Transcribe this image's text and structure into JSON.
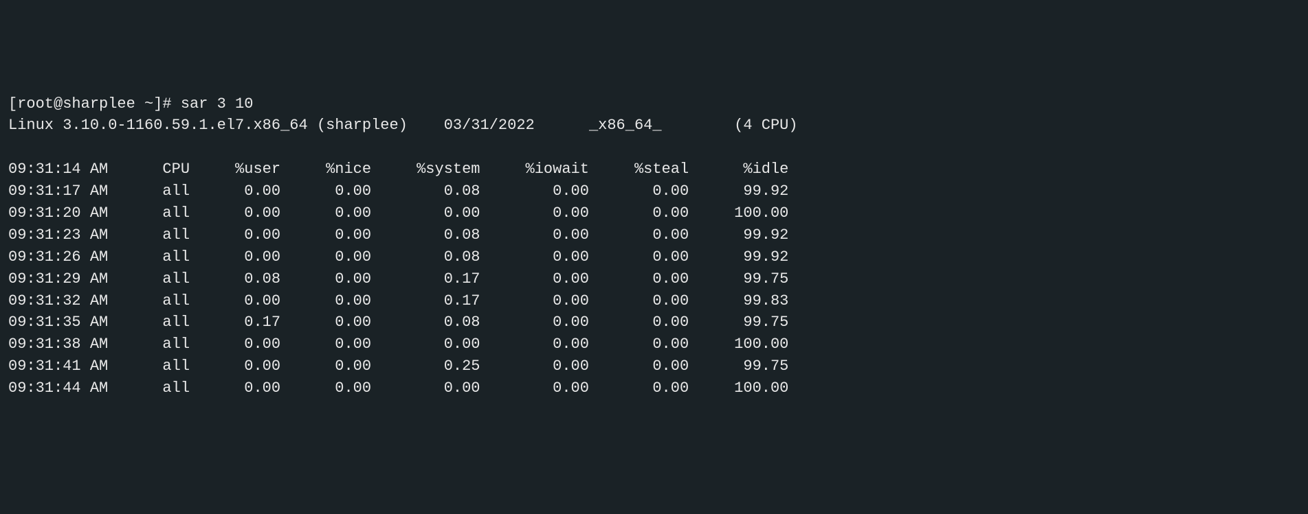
{
  "prompt": {
    "full": "[root@sharplee ~]# ",
    "command": "sar 3 10"
  },
  "sysinfo": {
    "line": "Linux 3.10.0-1160.59.1.el7.x86_64 (sharplee)    03/31/2022      _x86_64_        (4 CPU)"
  },
  "headers": {
    "time": "09:31:14 AM",
    "cpu": "CPU",
    "user": "%user",
    "nice": "%nice",
    "system": "%system",
    "iowait": "%iowait",
    "steal": "%steal",
    "idle": "%idle"
  },
  "rows": [
    {
      "time": "09:31:17 AM",
      "cpu": "all",
      "user": "0.00",
      "nice": "0.00",
      "system": "0.08",
      "iowait": "0.00",
      "steal": "0.00",
      "idle": "99.92"
    },
    {
      "time": "09:31:20 AM",
      "cpu": "all",
      "user": "0.00",
      "nice": "0.00",
      "system": "0.00",
      "iowait": "0.00",
      "steal": "0.00",
      "idle": "100.00"
    },
    {
      "time": "09:31:23 AM",
      "cpu": "all",
      "user": "0.00",
      "nice": "0.00",
      "system": "0.08",
      "iowait": "0.00",
      "steal": "0.00",
      "idle": "99.92"
    },
    {
      "time": "09:31:26 AM",
      "cpu": "all",
      "user": "0.00",
      "nice": "0.00",
      "system": "0.08",
      "iowait": "0.00",
      "steal": "0.00",
      "idle": "99.92"
    },
    {
      "time": "09:31:29 AM",
      "cpu": "all",
      "user": "0.08",
      "nice": "0.00",
      "system": "0.17",
      "iowait": "0.00",
      "steal": "0.00",
      "idle": "99.75"
    },
    {
      "time": "09:31:32 AM",
      "cpu": "all",
      "user": "0.00",
      "nice": "0.00",
      "system": "0.17",
      "iowait": "0.00",
      "steal": "0.00",
      "idle": "99.83"
    },
    {
      "time": "09:31:35 AM",
      "cpu": "all",
      "user": "0.17",
      "nice": "0.00",
      "system": "0.08",
      "iowait": "0.00",
      "steal": "0.00",
      "idle": "99.75"
    },
    {
      "time": "09:31:38 AM",
      "cpu": "all",
      "user": "0.00",
      "nice": "0.00",
      "system": "0.00",
      "iowait": "0.00",
      "steal": "0.00",
      "idle": "100.00"
    },
    {
      "time": "09:31:41 AM",
      "cpu": "all",
      "user": "0.00",
      "nice": "0.00",
      "system": "0.25",
      "iowait": "0.00",
      "steal": "0.00",
      "idle": "99.75"
    },
    {
      "time": "09:31:44 AM",
      "cpu": "all",
      "user": "0.00",
      "nice": "0.00",
      "system": "0.00",
      "iowait": "0.00",
      "steal": "0.00",
      "idle": "100.00"
    }
  ]
}
